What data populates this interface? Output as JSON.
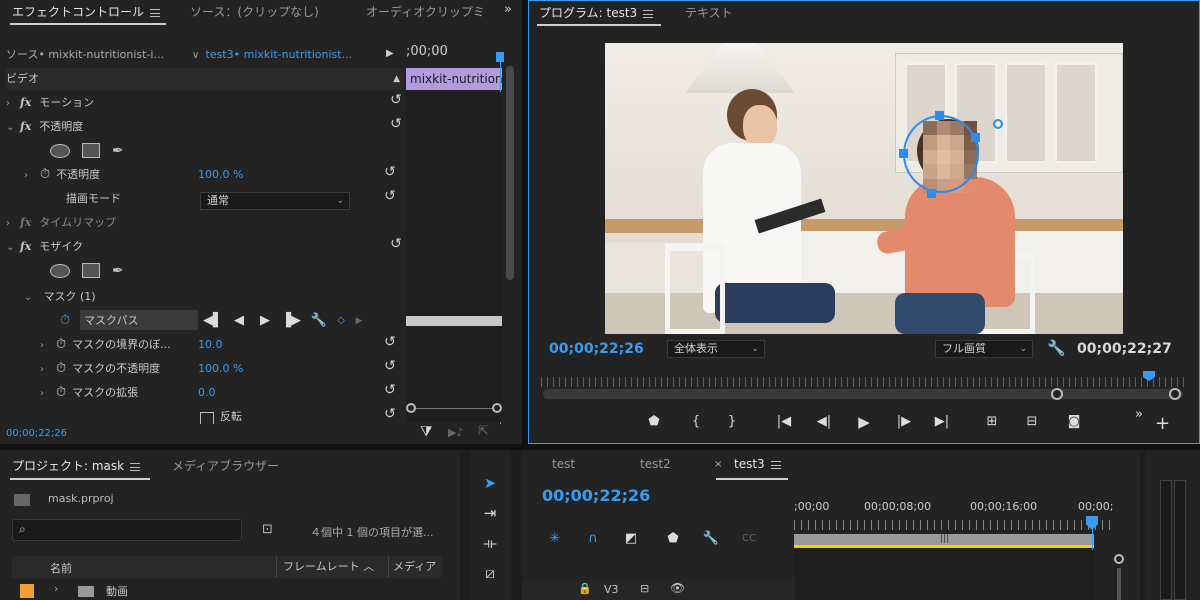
{
  "effect_controls": {
    "tabs": [
      "エフェクトコントロール",
      "ソース：(クリップなし)",
      "オーディオクリップミ"
    ],
    "source_label": "ソース• mixkit-nutritionist-i...",
    "sequence_label": "test3• mixkit-nutritionist...",
    "timecode_top": ";00;00",
    "clip_label": "mixkit-nutrition",
    "section_video": "ビデオ",
    "motion": "モーション",
    "opacity": "不透明度",
    "opacity_param": "不透明度",
    "opacity_value": "100.0 %",
    "blend_mode_label": "描画モード",
    "blend_mode_value": "通常",
    "time_remap": "タイムリマップ",
    "mosaic": "モザイク",
    "mask_group": "マスク (1)",
    "mask_path": "マスクパス",
    "mask_feather": "マスクの境界のぼ...",
    "mask_feather_value": "10.0",
    "mask_opacity": "マスクの不透明度",
    "mask_opacity_value": "100.0 %",
    "mask_expansion": "マスクの拡張",
    "mask_expansion_value": "0.0",
    "invert": "反転",
    "bottom_timecode": "00;00;22;26"
  },
  "program": {
    "tabs": [
      "プログラム: test3",
      "テキスト"
    ],
    "timecode_left": "00;00;22;26",
    "zoom_value": "全体表示",
    "quality_value": "フル画質",
    "timecode_right": "00;00;22;27"
  },
  "project": {
    "tabs": [
      "プロジェクト: mask",
      "メディアブラウザー"
    ],
    "filename": "mask.prproj",
    "search_placeholder": "",
    "item_count": "４個中 1 個の項目が選...",
    "col_name": "名前",
    "col_framerate": "フレームレート",
    "col_media": "メディア",
    "folder_name": "動画"
  },
  "timeline": {
    "tabs": [
      "test",
      "test2",
      "test3"
    ],
    "timecode": "00;00;22;26",
    "ruler": [
      ";00;00",
      "00;00;08;00",
      "00;00;16;00",
      "00;00;"
    ],
    "track_v3": "V3"
  },
  "colors": {
    "accent": "#3a9cf0",
    "clip": "#b49be0",
    "mask": "#2b8cf0"
  }
}
